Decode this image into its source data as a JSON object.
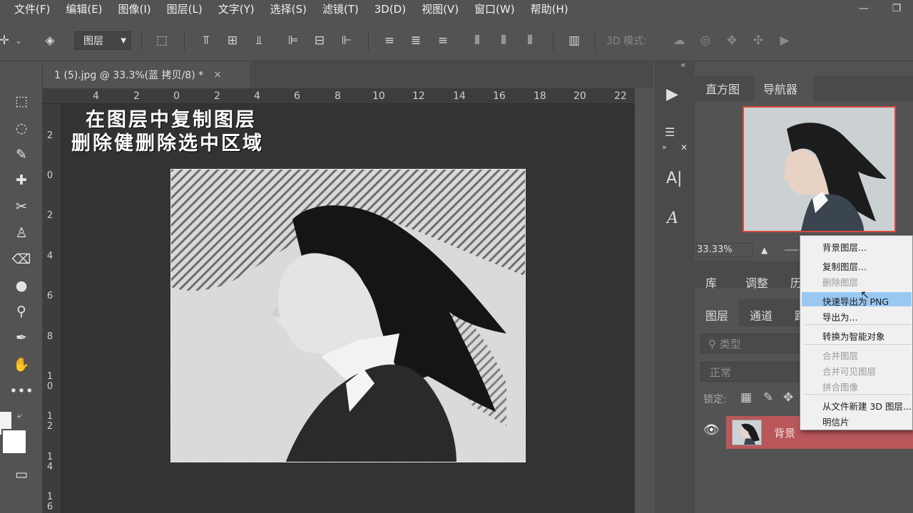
{
  "menubar": {
    "items": [
      "文件(F)",
      "编辑(E)",
      "图像(I)",
      "图层(L)",
      "文字(Y)",
      "选择(S)",
      "滤镜(T)",
      "3D(D)",
      "视图(V)",
      "窗口(W)",
      "帮助(H)"
    ],
    "minimize": "—",
    "restore": "❐"
  },
  "options": {
    "layer_select": "图层",
    "mode3d_label": "3D 模式:"
  },
  "document": {
    "tab_title": "1 (5).jpg @ 33.3%(蓝 拷贝/8) *",
    "close": "×"
  },
  "rulers": {
    "top": [
      "4",
      "2",
      "0",
      "2",
      "4",
      "6",
      "8",
      "10",
      "12",
      "14",
      "16",
      "18",
      "20",
      "22"
    ],
    "left": [
      "2",
      "0",
      "2",
      "4",
      "6",
      "8",
      "1\n0",
      "1\n2",
      "1\n4",
      "1\n6"
    ]
  },
  "annotation": {
    "line1": "在图层中复制图层",
    "line2": "删除健删除选中区域"
  },
  "right_panel": {
    "tab_histogram": "直方图",
    "tab_navigator": "导航器",
    "zoom": "33.33%",
    "tab_library": "库",
    "tab_adjust": "调整",
    "tab_history": "历",
    "tab_layers": "图层",
    "tab_channels": "通道",
    "tab_paths": "路",
    "search_placeholder": "类型",
    "blend_mode": "正常",
    "lock_label": "锁定:",
    "layer_name": "背景"
  },
  "context_menu": {
    "items": [
      {
        "label": "背景图层...",
        "disabled": false
      },
      {
        "label": "复制图层...",
        "disabled": false
      },
      {
        "label": "删除图层",
        "disabled": true
      },
      {
        "label": "快速导出为 PNG",
        "disabled": false,
        "highlighted": true
      },
      {
        "label": "导出为...",
        "disabled": false
      },
      {
        "label": "转换为智能对象",
        "disabled": false
      },
      {
        "label": "合并图层",
        "disabled": true
      },
      {
        "label": "合并可见图层",
        "disabled": true
      },
      {
        "label": "拼合图像",
        "disabled": true
      },
      {
        "label": "从文件新建 3D 图层...",
        "disabled": false
      },
      {
        "label": "明信片",
        "disabled": false
      }
    ]
  },
  "colors": {
    "ui_bg": "#535353",
    "canvas_bg": "#333335",
    "selected_layer": "#b9575a",
    "menu_highlight": "#99c8f3",
    "navigator_frame": "#d9493f"
  },
  "icons": {
    "eye": "eye-icon",
    "play": "play-icon",
    "type_tool": "type-icon"
  }
}
